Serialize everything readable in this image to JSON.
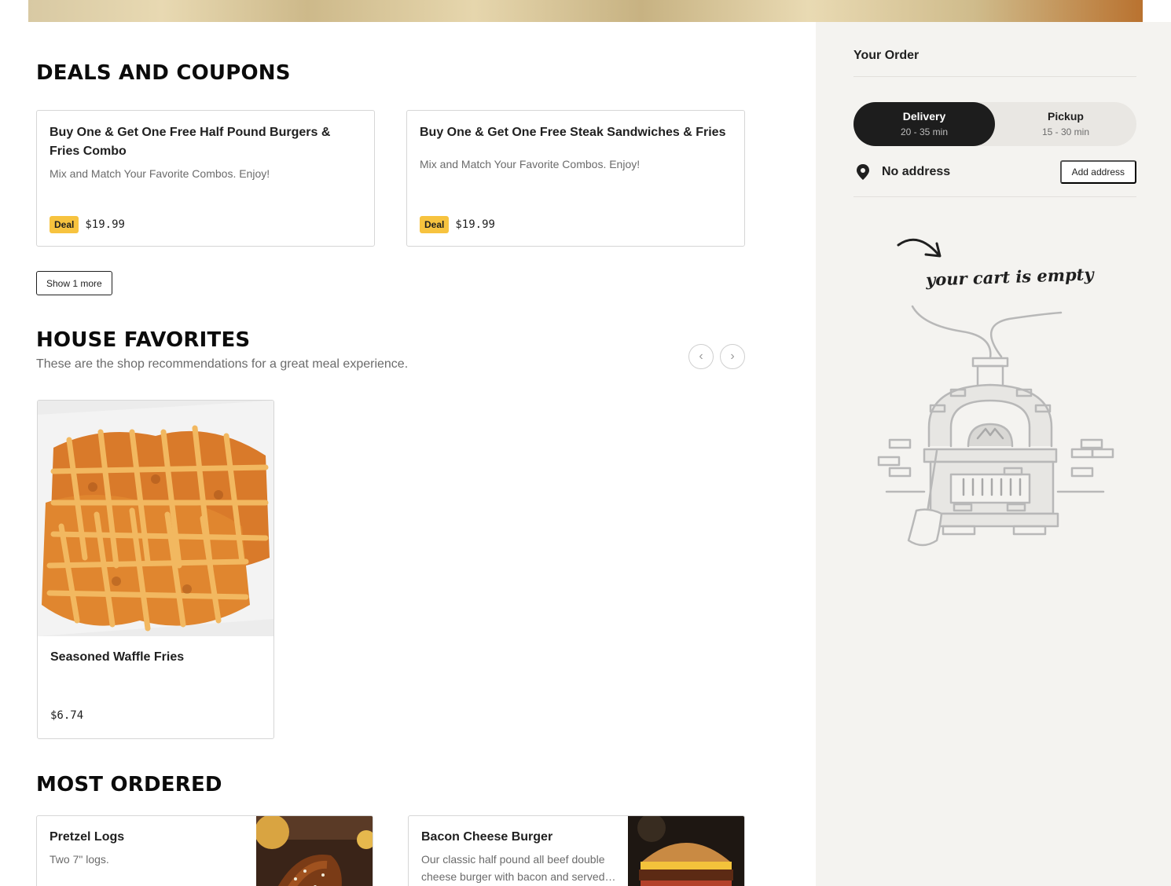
{
  "deals": {
    "title": "DEALS AND COUPONS",
    "cards": [
      {
        "title": "Buy One & Get One Free Half Pound Burgers & Fries Combo",
        "description": "Mix and Match Your Favorite Combos. Enjoy!",
        "badge": "Deal",
        "price": "$19.99"
      },
      {
        "title": "Buy One & Get One Free Steak Sandwiches & Fries",
        "description": "Mix and Match Your Favorite Combos. Enjoy!",
        "badge": "Deal",
        "price": "$19.99"
      }
    ],
    "show_more_label": "Show 1 more"
  },
  "favorites": {
    "title": "HOUSE FAVORITES",
    "subtitle": "These are the shop recommendations for a great meal experience.",
    "prev_icon": "chevron-left-icon",
    "next_icon": "chevron-right-icon",
    "items": [
      {
        "name": "Seasoned Waffle Fries",
        "price": "$6.74"
      }
    ]
  },
  "most_ordered": {
    "title": "MOST ORDERED",
    "items": [
      {
        "name": "Pretzel Logs",
        "description": "Two 7\" logs."
      },
      {
        "name": "Bacon Cheese Burger",
        "description": "Our classic half pound all beef double cheese burger with bacon and served…"
      }
    ]
  },
  "order": {
    "title": "Your Order",
    "modes": [
      {
        "label": "Delivery",
        "time": "20 - 35 min",
        "active": true
      },
      {
        "label": "Pickup",
        "time": "15 - 30 min",
        "active": false
      }
    ],
    "address": {
      "icon": "location-pin-icon",
      "text": "No address",
      "button_label": "Add address"
    },
    "empty_message": "your cart is empty"
  },
  "colors": {
    "accent_badge": "#f7c33f",
    "toggle_active": "#1d1d1d",
    "sidebar_bg": "#f4f3f0"
  }
}
